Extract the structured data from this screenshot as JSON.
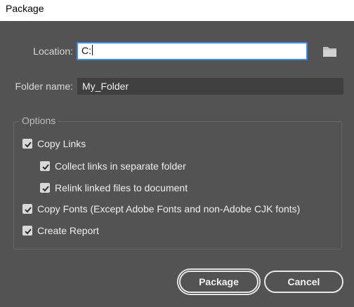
{
  "window": {
    "title": "Package"
  },
  "fields": {
    "location_label": "Location:",
    "location_value": "C:",
    "folder_name_label": "Folder name:",
    "folder_name_value": "My_Folder"
  },
  "options": {
    "legend": "Options",
    "items": [
      {
        "label": "Copy Links",
        "checked": true
      },
      {
        "label": "Collect links in separate folder",
        "checked": true
      },
      {
        "label": "Relink linked files to document",
        "checked": true
      },
      {
        "label": "Copy Fonts (Except Adobe Fonts and non-Adobe CJK fonts)",
        "checked": true
      },
      {
        "label": "Create Report",
        "checked": true
      }
    ]
  },
  "buttons": {
    "package_label": "Package",
    "cancel_label": "Cancel"
  },
  "icons": {
    "browse": "folder-icon",
    "check": "checkmark-icon"
  },
  "colors": {
    "background": "#535353",
    "focus_border": "#378ef0"
  }
}
